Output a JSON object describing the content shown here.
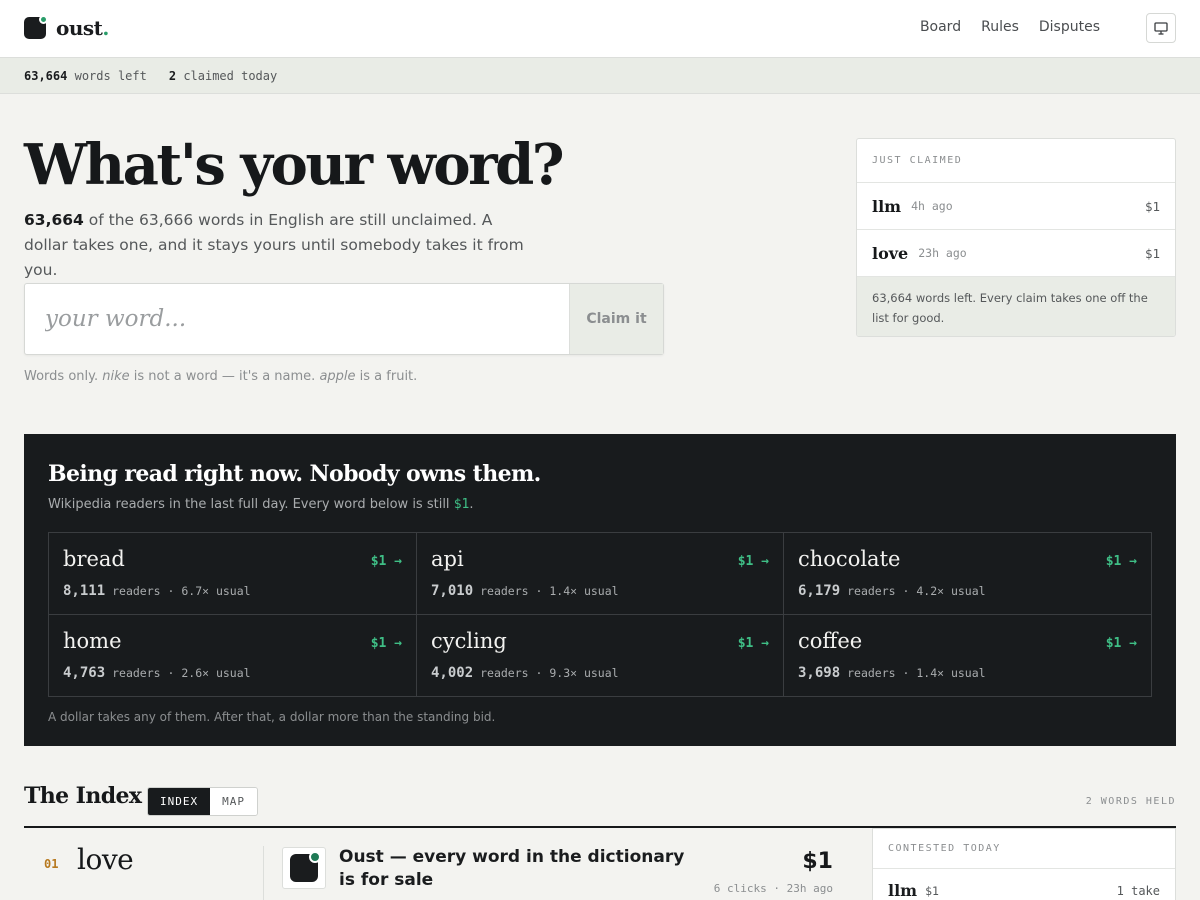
{
  "header": {
    "brand": "oust",
    "brand_dot": ".",
    "nav": [
      "Board",
      "Rules",
      "Disputes"
    ],
    "display_icon": "monitor-icon"
  },
  "stats": {
    "words_left_num": "63,664",
    "words_left_label": "words left",
    "claimed_num": "2",
    "claimed_label": "claimed today"
  },
  "hero": {
    "title": "What's your word?",
    "sub_bold": "63,664",
    "sub_rest": " of the 63,666 words in English are still unclaimed. A dollar takes one, and it stays yours until somebody takes it from you.",
    "input_placeholder": "your word...",
    "claim_button": "Claim it",
    "hint_1": "Words only. ",
    "hint_nike": "nike",
    "hint_2": " is not a word — it's a name. ",
    "hint_apple": "apple",
    "hint_3": " is a fruit."
  },
  "just_claimed": {
    "heading": "JUST CLAIMED",
    "items": [
      {
        "word": "llm",
        "time": "4h ago",
        "price": "$1"
      },
      {
        "word": "love",
        "time": "23h ago",
        "price": "$1"
      }
    ],
    "footer": "63,664 words left. Every claim takes one off the list for good."
  },
  "trending": {
    "title": "Being read right now. Nobody owns them.",
    "sub_text": "Wikipedia readers in the last full day. Every word below is still ",
    "sub_price": "$1",
    "sub_end": ".",
    "items": [
      {
        "word": "bread",
        "price": "$1 →",
        "readers": "8,111",
        "readers_label": "readers",
        "usual": "· 6.7× usual"
      },
      {
        "word": "api",
        "price": "$1 →",
        "readers": "7,010",
        "readers_label": "readers",
        "usual": "· 1.4× usual"
      },
      {
        "word": "chocolate",
        "price": "$1 →",
        "readers": "6,179",
        "readers_label": "readers",
        "usual": "· 4.2× usual"
      },
      {
        "word": "home",
        "price": "$1 →",
        "readers": "4,763",
        "readers_label": "readers",
        "usual": "· 2.6× usual"
      },
      {
        "word": "cycling",
        "price": "$1 →",
        "readers": "4,002",
        "readers_label": "readers",
        "usual": "· 9.3× usual"
      },
      {
        "word": "coffee",
        "price": "$1 →",
        "readers": "3,698",
        "readers_label": "readers",
        "usual": "· 1.4× usual"
      }
    ],
    "footer": "A dollar takes any of them. After that, a dollar more than the standing bid."
  },
  "index": {
    "title": "The Index",
    "tabs": [
      "INDEX",
      "MAP"
    ],
    "active_tab": "INDEX",
    "held": "2 WORDS HELD",
    "entry": {
      "num": "01",
      "word": "love",
      "link_title": "Oust — every word in the dictionary is for sale",
      "price": "$1",
      "meta": "6 clicks · 23h ago"
    },
    "contested": {
      "heading": "CONTESTED TODAY",
      "word": "llm",
      "price": "$1",
      "takes": "1 take"
    }
  }
}
